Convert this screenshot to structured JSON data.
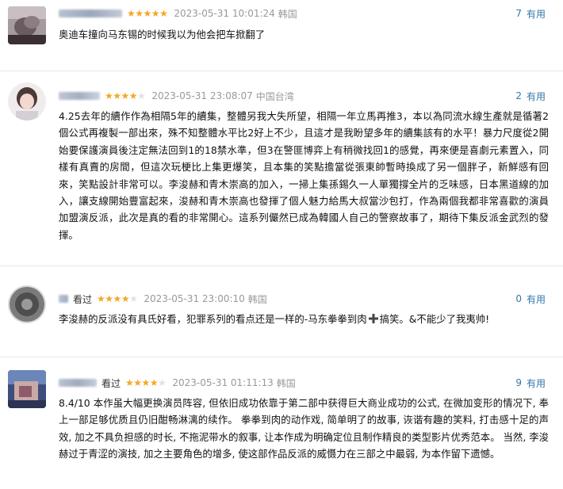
{
  "colors": {
    "star_filled": "#f6a623",
    "star_empty": "#e2e2e2",
    "meta_gray": "#999999",
    "link_blue": "#3377aa"
  },
  "reviews": [
    {
      "watched_label": "",
      "rating": 5,
      "date": "2023-05-31 10:01:24",
      "region": "韩国",
      "useful_count": "7",
      "useful_label": "有用",
      "content": "奥迪车撞向马东锡的时候我以为他会把车掀翻了"
    },
    {
      "watched_label": "",
      "rating": 4,
      "date": "2023-05-31 23:08:07",
      "region": "中国台湾",
      "useful_count": "2",
      "useful_label": "有用",
      "content": "4.25去年的續作作為相隔5年的續集，整體另我大失所望，相隔一年立馬再推3，本以為同流水線生產就是循著2個公式再複製一部出來，殊不知整體水平比2好上不少，且這才是我盼望多年的續集該有的水平！暴力尺度從2開始要保護演員後注定無法回到1的18禁水準，但3在警匪博弈上有稍微找回1的感覺，再來便是喜劇元素置入，同樣有真賣的房間，但這次玩梗比上集更爆笑，且本集的笑點擔當從張東帥暫時換成了另一個胖子，新鮮感有回來，笑點設計非常可以。李浚赫和青木崇高的加入，一掃上集孫錫久一人單獨撐全片的乏味感，日本黑道線的加入，讓支線開始豐富起來，浚赫和青木崇高也發揮了個人魅力給馬大叔當沙包打，作為兩個我都非常喜歡的演員加盟演反派，此次是真的看的非常開心。這系列儼然已成為韓國人自己的警察故事了，期待下集反派金武烈的發揮。"
    },
    {
      "watched_label": "看过",
      "rating": 4,
      "date": "2023-05-31 23:00:10",
      "region": "韩国",
      "useful_count": "0",
      "useful_label": "有用",
      "content_before": "李浚赫的反派没有具氏好看，犯罪系列的看点还是一样的-马东拳拳到肉",
      "content_after": "搞笑。&不能少了我夷帅!"
    },
    {
      "watched_label": "看过",
      "rating": 4,
      "date": "2023-05-31 01:11:13",
      "region": "韩国",
      "useful_count": "9",
      "useful_label": "有用",
      "content": "8.4/10 本作虽大幅更换演员阵容, 但依旧成功依靠于第二部中获得巨大商业成功的公式, 在微加变形的情况下, 奉上一部足够优质且仍旧酣畅淋漓的续作。 拳拳到肉的动作戏, 简单明了的故事, 诙谐有趣的笑料, 打击感十足的声效, 加之不具负担感的时长, 不拖泥带水的叙事, 让本作成为明确定位且制作精良的类型影片优秀范本。 当然, 李浚赫过于青涩的演技, 加之主要角色的增多, 使这部作品反派的威慑力在三部之中最弱, 为本作留下遗憾。"
    }
  ]
}
